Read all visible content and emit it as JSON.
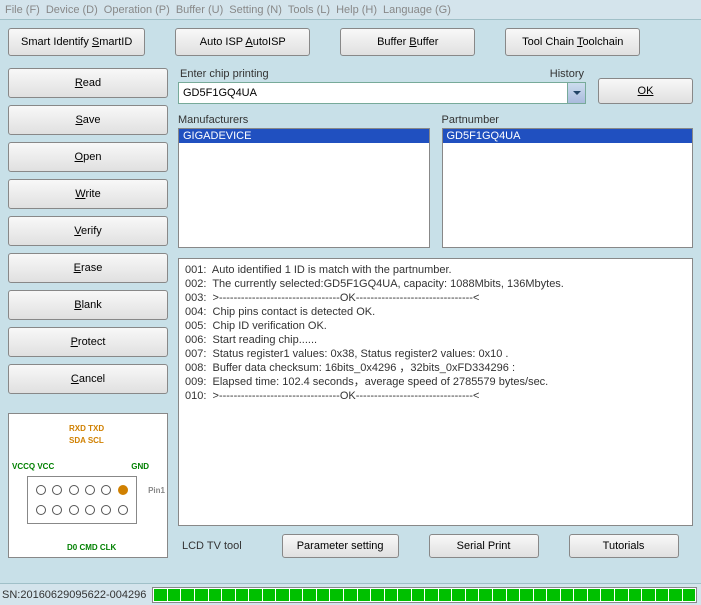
{
  "menu": {
    "file": "File (F)",
    "device": "Device (D)",
    "operation": "Operation (P)",
    "buffer": "Buffer (U)",
    "setting": "Setting (N)",
    "tools": "Tools (L)",
    "help": "Help (H)",
    "language": "Language (G)"
  },
  "topbar": {
    "smartid": "Smart Identify SmartID",
    "autoisp": "Auto ISP AutoISP",
    "buffer": "Buffer Buffer",
    "toolchain": "Tool Chain Toolchain"
  },
  "leftbtn": {
    "read": "Read",
    "save": "Save",
    "open": "Open",
    "write": "Write",
    "verify": "Verify",
    "erase": "Erase",
    "blank": "Blank",
    "protect": "Protect",
    "cancel": "Cancel"
  },
  "diagram": {
    "rxd": "RXD TXD",
    "sda": "SDA SCL",
    "vccq": "VCCQ  VCC",
    "gnd": "GND",
    "pin1": "Pin1",
    "d0": "D0    CMD  CLK"
  },
  "chip": {
    "enter_label": "Enter chip printing",
    "history_label": "History",
    "value": "GD5F1GQ4UA",
    "ok": "OK"
  },
  "lists": {
    "mfg_label": "Manufacturers",
    "mfg_item": "GIGADEVICE",
    "part_label": "Partnumber",
    "part_item": "GD5F1GQ4UA"
  },
  "log": [
    "001:  Auto identified 1 ID is match with the partnumber.",
    "002:  The currently selected:GD5F1GQ4UA, capacity: 1088Mbits, 136Mbytes.",
    "003:  >---------------------------------OK--------------------------------<",
    "004:  Chip pins contact is detected OK.",
    "005:  Chip ID verification OK.",
    "006:  Start reading chip......",
    "007:  Status register1 values: 0x38, Status register2 values: 0x10 .",
    "008:  Buffer data checksum: 16bits_0x4296 ，32bits_0xFD334296 :",
    "009:  Elapsed time: 102.4 seconds，average speed of 2785579 bytes/sec.",
    "010:  >---------------------------------OK--------------------------------<"
  ],
  "footer": {
    "title": "LCD TV tool",
    "param": "Parameter setting",
    "serial": "Serial Print",
    "tut": "Tutorials"
  },
  "status": {
    "sn": "SN:20160629095622-004296"
  }
}
